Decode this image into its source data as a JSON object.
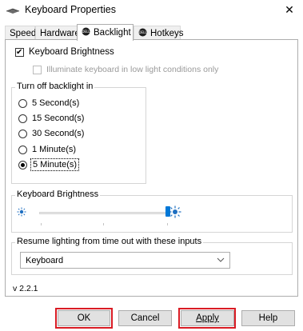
{
  "window": {
    "title": "Keyboard Properties",
    "close_glyph": "✕"
  },
  "tabs": [
    {
      "label": "Speed",
      "icon": null
    },
    {
      "label": "Hardware",
      "icon": null
    },
    {
      "label": "Backlight",
      "icon": "dell-logo-icon"
    },
    {
      "label": "Hotkeys",
      "icon": "dell-logo-icon"
    }
  ],
  "active_tab": "Backlight",
  "backlight": {
    "keyboard_brightness_checkbox": {
      "label": "Keyboard Brightness",
      "checked": true
    },
    "illuminate_checkbox": {
      "label": "Illuminate keyboard in low light conditions only",
      "checked": false,
      "disabled": true
    },
    "turn_off_group": {
      "title": "Turn off backlight in",
      "options": [
        "5 Second(s)",
        "15 Second(s)",
        "30 Second(s)",
        "1 Minute(s)",
        "5 Minute(s)"
      ],
      "selected": "5 Minute(s)"
    },
    "brightness_group": {
      "title": "Keyboard Brightness",
      "level_percent": 100,
      "low_icon": "sun-low-icon",
      "high_icon": "sun-high-icon"
    },
    "resume_group": {
      "title": "Resume lighting from time out with these inputs",
      "selected": "Keyboard"
    },
    "version": "v 2.2.1"
  },
  "buttons": {
    "ok": "OK",
    "cancel": "Cancel",
    "apply": "Apply",
    "help": "Help"
  },
  "colors": {
    "accent": "#0078d7",
    "highlight": "#d91c24"
  }
}
